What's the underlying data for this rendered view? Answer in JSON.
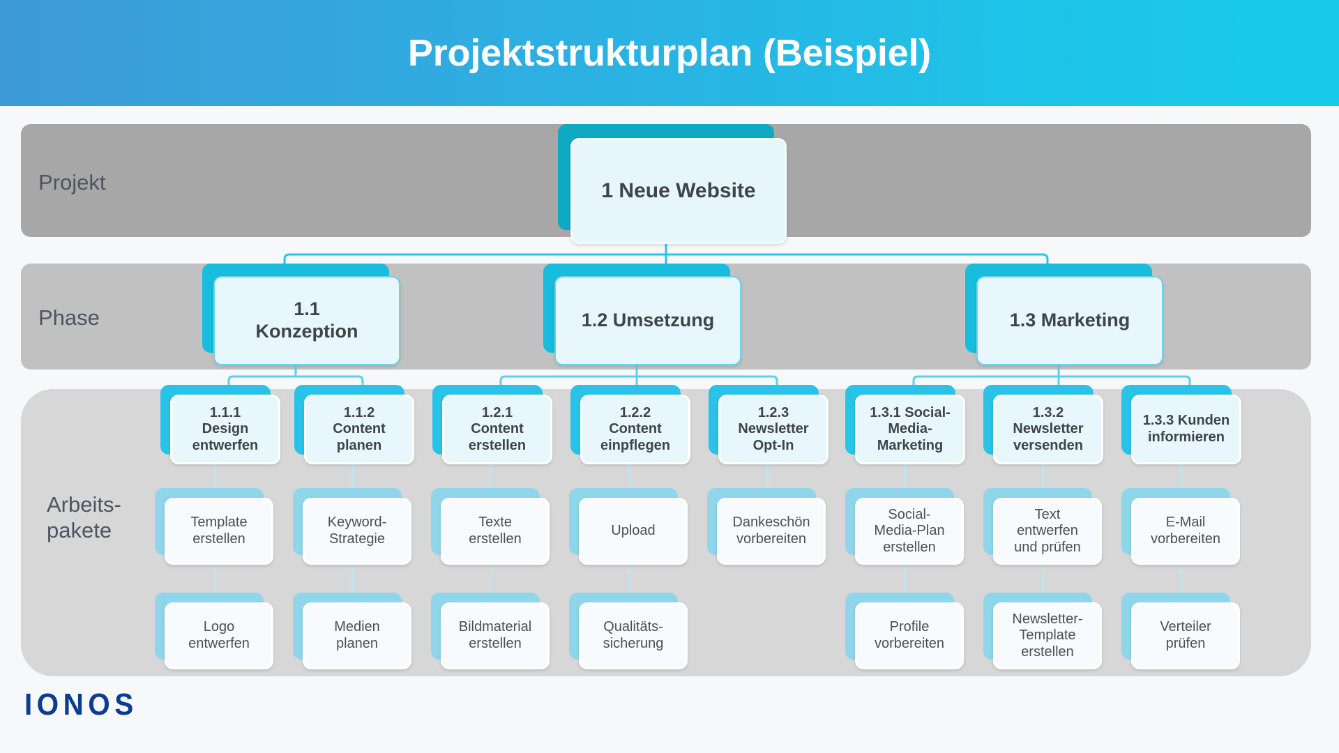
{
  "header": {
    "title": "Projektstrukturplan (Beispiel)",
    "gradient_from": "#3d9ad6",
    "gradient_to": "#19cbe9"
  },
  "rows": {
    "projekt_label": "Projekt",
    "phase_label": "Phase",
    "pakete_label": "Arbeits-\npakete",
    "projekt_band_color": "#a7a7a7",
    "phase_band_color": "#c1c1c1",
    "pakete_band_color": "#d7d7d7"
  },
  "colors": {
    "accent_teal": "#0fa9c2",
    "accent_cyan": "#18bcdd",
    "accent_light_cyan": "#29c3e8",
    "accent_pale_blue": "#8fd6ea",
    "card_fill": "#e8f7fb",
    "wp_fill": "#f7fbfd",
    "connector": "#5ccfee",
    "text": "#3f4448",
    "logo": "#0a3d8f"
  },
  "root": {
    "label": "1 Neue Website"
  },
  "phases": [
    {
      "id": "1.1",
      "label": "1.1\nKonzeption"
    },
    {
      "id": "1.2",
      "label": "1.2 Umsetzung"
    },
    {
      "id": "1.3",
      "label": "1.3 Marketing"
    }
  ],
  "tasks": [
    {
      "id": "1.1.1",
      "label": "1.1.1\nDesign\nentwerfen",
      "phase": "1.1"
    },
    {
      "id": "1.1.2",
      "label": "1.1.2\nContent\nplanen",
      "phase": "1.1"
    },
    {
      "id": "1.2.1",
      "label": "1.2.1\nContent\nerstellen",
      "phase": "1.2"
    },
    {
      "id": "1.2.2",
      "label": "1.2.2\nContent\neinpflegen",
      "phase": "1.2"
    },
    {
      "id": "1.2.3",
      "label": "1.2.3\nNewsletter\nOpt-In",
      "phase": "1.2"
    },
    {
      "id": "1.3.1",
      "label": "1.3.1 Social-\nMedia-\nMarketing",
      "phase": "1.3"
    },
    {
      "id": "1.3.2",
      "label": "1.3.2\nNewsletter\nversenden",
      "phase": "1.3"
    },
    {
      "id": "1.3.3",
      "label": "1.3.3 Kunden\ninformieren",
      "phase": "1.3"
    }
  ],
  "work_packages_row1": [
    {
      "label": "Template\nerstellen",
      "task": "1.1.1"
    },
    {
      "label": "Keyword-\nStrategie",
      "task": "1.1.2"
    },
    {
      "label": "Texte\nerstellen",
      "task": "1.2.1"
    },
    {
      "label": "Upload",
      "task": "1.2.2"
    },
    {
      "label": "Dankeschön\nvorbereiten",
      "task": "1.2.3"
    },
    {
      "label": "Social-\nMedia-Plan\nerstellen",
      "task": "1.3.1"
    },
    {
      "label": "Text\nentwerfen\nund prüfen",
      "task": "1.3.2"
    },
    {
      "label": "E-Mail\nvorbereiten",
      "task": "1.3.3"
    }
  ],
  "work_packages_row2": [
    {
      "label": "Logo\nentwerfen",
      "task": "1.1.1"
    },
    {
      "label": "Medien\nplanen",
      "task": "1.1.2"
    },
    {
      "label": "Bildmaterial\nerstellen",
      "task": "1.2.1"
    },
    {
      "label": "Qualitäts-\nsicherung",
      "task": "1.2.2"
    },
    {
      "label": "Profile\nvorbereiten",
      "task": "1.3.1"
    },
    {
      "label": "Newsletter-\nTemplate\nerstellen",
      "task": "1.3.2"
    },
    {
      "label": "Verteiler\nprüfen",
      "task": "1.3.3"
    }
  ],
  "brand": {
    "logo_text": "IONOS"
  }
}
